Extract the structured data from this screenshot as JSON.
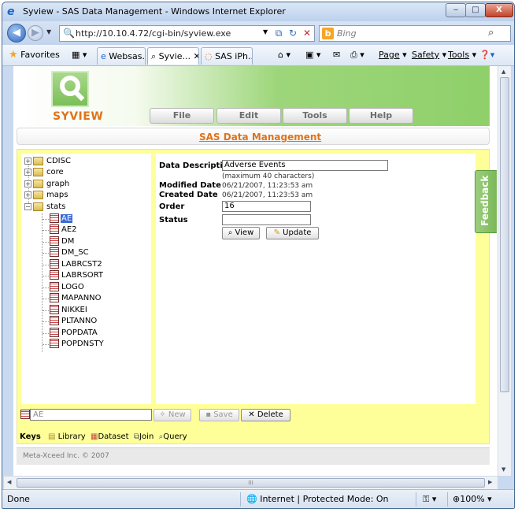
{
  "window": {
    "title": "Syview - SAS Data Management - Windows Internet Explorer",
    "min_glyph": "‒",
    "max_glyph": "□",
    "close_glyph": "X"
  },
  "address": {
    "url": "http://10.10.4.72/cgi-bin/syview.exe",
    "search_placeholder": "Bing"
  },
  "favorites": {
    "label": "Favorites",
    "tabs": [
      {
        "label": "Websas..."
      },
      {
        "label": "Syvie..."
      },
      {
        "label": "SAS iPh..."
      }
    ],
    "commands": {
      "page": "Page",
      "safety": "Safety",
      "tools": "Tools"
    }
  },
  "app": {
    "logo_text": "SYVIEW",
    "menu": [
      "File",
      "Edit",
      "Tools",
      "Help"
    ],
    "page_title": "SAS Data Management",
    "tree": {
      "folders": [
        "CDISC",
        "core",
        "graph",
        "maps",
        "stats"
      ],
      "datasets": [
        "AE",
        "AE2",
        "DM",
        "DM_SC",
        "LABRCST2",
        "LABRSORT",
        "LOGO",
        "MAPANNO",
        "NIKKEI",
        "PLTANNO",
        "POPDATA",
        "POPDNSTY"
      ]
    },
    "form": {
      "data_description_label": "Data Description",
      "data_description_value": "Adverse Events",
      "max_hint": "(maximum 40 characters)",
      "modified_label": "Modified Date",
      "modified_value": "06/21/2007, 11:23:53 am",
      "created_label": "Created Date",
      "created_value": "06/21/2007, 11:23:53 am",
      "order_label": "Order",
      "order_value": "16",
      "status_label": "Status",
      "status_value": "",
      "view_button": "View",
      "update_button": "Update"
    },
    "bottom": {
      "name_value": "AE",
      "new_button": "New",
      "save_button": "Save",
      "delete_button": "Delete"
    },
    "keys": {
      "label": "Keys",
      "library": "Library",
      "dataset": "Dataset",
      "join": "Join",
      "query": "Query"
    },
    "footer": "Meta-Xceed Inc. © 2007",
    "feedback": "Feedback"
  },
  "status": {
    "left": "Done",
    "zone": "Internet | Protected Mode: On",
    "zoom": "100%"
  },
  "colors": {
    "accent_orange": "#e0731b",
    "panel_yellow": "#ffff99",
    "banner_green": "#8fd06a",
    "selection_blue": "#3a6ad8"
  }
}
